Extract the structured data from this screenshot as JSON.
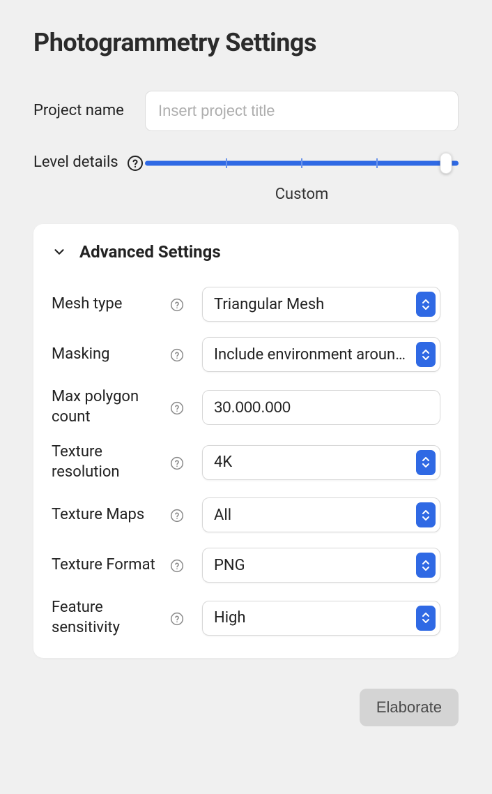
{
  "page_title": "Photogrammetry Settings",
  "project_name": {
    "label": "Project name",
    "value": "",
    "placeholder": "Insert project title"
  },
  "level_details": {
    "label": "Level details",
    "value_label": "Custom",
    "slider_percent": 96
  },
  "advanced": {
    "title": "Advanced Settings",
    "mesh_type": {
      "label": "Mesh type",
      "value": "Triangular Mesh"
    },
    "masking": {
      "label": "Masking",
      "value": "Include environment around object"
    },
    "max_polygon": {
      "label": "Max polygon count",
      "value": "30.000.000"
    },
    "texture_res": {
      "label": "Texture resolution",
      "value": "4K"
    },
    "texture_maps": {
      "label": "Texture Maps",
      "value": "All"
    },
    "texture_format": {
      "label": "Texture Format",
      "value": "PNG"
    },
    "feature_sens": {
      "label": "Feature sensitivity",
      "value": "High"
    }
  },
  "elaborate_label": "Elaborate"
}
